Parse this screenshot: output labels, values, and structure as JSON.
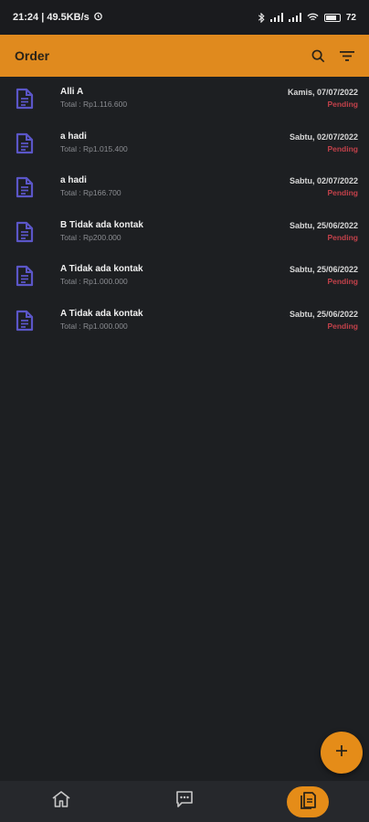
{
  "status_bar": {
    "time_speed": "21:24 | 49.5KB/s",
    "battery": "72"
  },
  "app_bar": {
    "title": "Order",
    "icons": [
      "search-icon",
      "filter-icon"
    ]
  },
  "orders": [
    {
      "name": "Alli A",
      "total": "Total : Rp1.116.600",
      "date": "Kamis, 07/07/2022",
      "status": "Pending"
    },
    {
      "name": "a hadi",
      "total": "Total : Rp1.015.400",
      "date": "Sabtu, 02/07/2022",
      "status": "Pending"
    },
    {
      "name": "a hadi",
      "total": "Total : Rp166.700",
      "date": "Sabtu, 02/07/2022",
      "status": "Pending"
    },
    {
      "name": "B Tidak ada kontak",
      "total": "Total : Rp200.000",
      "date": "Sabtu, 25/06/2022",
      "status": "Pending"
    },
    {
      "name": "A Tidak ada kontak",
      "total": "Total : Rp1.000.000",
      "date": "Sabtu, 25/06/2022",
      "status": "Pending"
    },
    {
      "name": "A Tidak ada kontak",
      "total": "Total : Rp1.000.000",
      "date": "Sabtu, 25/06/2022",
      "status": "Pending"
    }
  ],
  "fab": {
    "icon": "plus-icon"
  },
  "bottom_nav": {
    "items": [
      "home-icon",
      "chat-icon",
      "orders-icon"
    ],
    "active": "orders-icon"
  },
  "colors": {
    "accent": "#e08a1e",
    "background": "#1d1f22",
    "status_pending": "#c2414a",
    "doc_icon": "#5b56c8"
  }
}
